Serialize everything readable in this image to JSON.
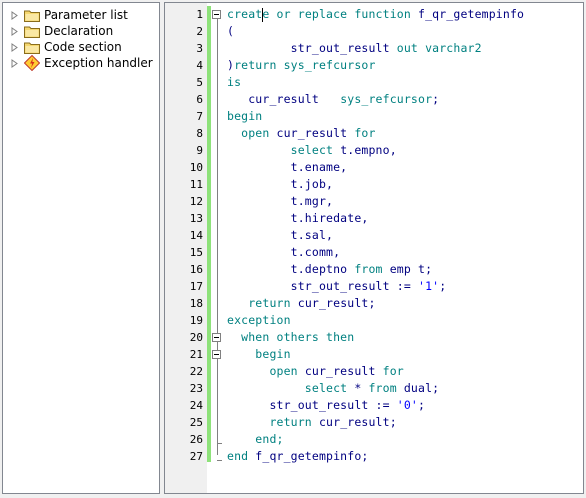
{
  "tree": {
    "items": [
      {
        "label": "Parameter list",
        "icon": "folder-icon"
      },
      {
        "label": "Declaration",
        "icon": "folder-icon"
      },
      {
        "label": "Code section",
        "icon": "folder-icon"
      },
      {
        "label": "Exception handler",
        "icon": "exception-icon"
      }
    ]
  },
  "colors": {
    "keyword": "#008080",
    "identifier": "#000080",
    "string": "#0000ff",
    "change_bar": "#8ee27a"
  },
  "editor": {
    "lines": [
      {
        "num": "1",
        "tokens": [
          {
            "t": "creat",
            "c": "kw"
          },
          {
            "t": "|cursor|",
            "c": "cursor"
          },
          {
            "t": "e or replace function ",
            "c": "kw"
          },
          {
            "t": "f_qr_getempinfo",
            "c": "tx"
          }
        ]
      },
      {
        "num": "2",
        "tokens": [
          {
            "t": "(",
            "c": "tx"
          }
        ]
      },
      {
        "num": "3",
        "tokens": [
          {
            "t": "         str_out_result ",
            "c": "tx"
          },
          {
            "t": "out varchar2",
            "c": "kw"
          }
        ]
      },
      {
        "num": "4",
        "tokens": [
          {
            "t": ")",
            "c": "tx"
          },
          {
            "t": "return ",
            "c": "kw"
          },
          {
            "t": "sys_refcursor",
            "c": "kw"
          }
        ]
      },
      {
        "num": "5",
        "tokens": [
          {
            "t": "is",
            "c": "kw"
          }
        ]
      },
      {
        "num": "6",
        "tokens": [
          {
            "t": "   cur_result   ",
            "c": "tx"
          },
          {
            "t": "sys_refcursor",
            "c": "kw"
          },
          {
            "t": ";",
            "c": "tx"
          }
        ]
      },
      {
        "num": "7",
        "tokens": [
          {
            "t": "begin",
            "c": "kw"
          }
        ]
      },
      {
        "num": "8",
        "tokens": [
          {
            "t": "  open ",
            "c": "kw"
          },
          {
            "t": "cur_result ",
            "c": "tx"
          },
          {
            "t": "for",
            "c": "kw"
          }
        ]
      },
      {
        "num": "9",
        "tokens": [
          {
            "t": "         select ",
            "c": "kw"
          },
          {
            "t": "t.empno,",
            "c": "tx"
          }
        ]
      },
      {
        "num": "10",
        "tokens": [
          {
            "t": "         t.ename,",
            "c": "tx"
          }
        ]
      },
      {
        "num": "11",
        "tokens": [
          {
            "t": "         t.job,",
            "c": "tx"
          }
        ]
      },
      {
        "num": "12",
        "tokens": [
          {
            "t": "         t.mgr,",
            "c": "tx"
          }
        ]
      },
      {
        "num": "13",
        "tokens": [
          {
            "t": "         t.hiredate,",
            "c": "tx"
          }
        ]
      },
      {
        "num": "14",
        "tokens": [
          {
            "t": "         t.sal,",
            "c": "tx"
          }
        ]
      },
      {
        "num": "15",
        "tokens": [
          {
            "t": "         t.comm,",
            "c": "tx"
          }
        ]
      },
      {
        "num": "16",
        "tokens": [
          {
            "t": "         t.deptno ",
            "c": "tx"
          },
          {
            "t": "from ",
            "c": "kw"
          },
          {
            "t": "emp t;",
            "c": "tx"
          }
        ]
      },
      {
        "num": "17",
        "tokens": [
          {
            "t": "         str_out_result := ",
            "c": "tx"
          },
          {
            "t": "'1'",
            "c": "st"
          },
          {
            "t": ";",
            "c": "tx"
          }
        ]
      },
      {
        "num": "18",
        "tokens": [
          {
            "t": "   return ",
            "c": "kw"
          },
          {
            "t": "cur_result;",
            "c": "tx"
          }
        ]
      },
      {
        "num": "19",
        "tokens": [
          {
            "t": "exception",
            "c": "kw"
          }
        ]
      },
      {
        "num": "20",
        "tokens": [
          {
            "t": "  when others then",
            "c": "kw"
          }
        ]
      },
      {
        "num": "21",
        "tokens": [
          {
            "t": "    begin",
            "c": "kw"
          }
        ]
      },
      {
        "num": "22",
        "tokens": [
          {
            "t": "      open ",
            "c": "kw"
          },
          {
            "t": "cur_result ",
            "c": "tx"
          },
          {
            "t": "for",
            "c": "kw"
          }
        ]
      },
      {
        "num": "23",
        "tokens": [
          {
            "t": "           select ",
            "c": "kw"
          },
          {
            "t": "* ",
            "c": "tx"
          },
          {
            "t": "from ",
            "c": "kw"
          },
          {
            "t": "dual;",
            "c": "tx"
          }
        ]
      },
      {
        "num": "24",
        "tokens": [
          {
            "t": "      str_out_result := ",
            "c": "tx"
          },
          {
            "t": "'0'",
            "c": "st"
          },
          {
            "t": ";",
            "c": "tx"
          }
        ]
      },
      {
        "num": "25",
        "tokens": [
          {
            "t": "      return ",
            "c": "kw"
          },
          {
            "t": "cur_result;",
            "c": "tx"
          }
        ]
      },
      {
        "num": "26",
        "tokens": [
          {
            "t": "    end;",
            "c": "kw"
          }
        ]
      },
      {
        "num": "27",
        "tokens": [
          {
            "t": "end ",
            "c": "kw"
          },
          {
            "t": "f_qr_getempinfo;",
            "c": "tx"
          }
        ]
      }
    ]
  }
}
